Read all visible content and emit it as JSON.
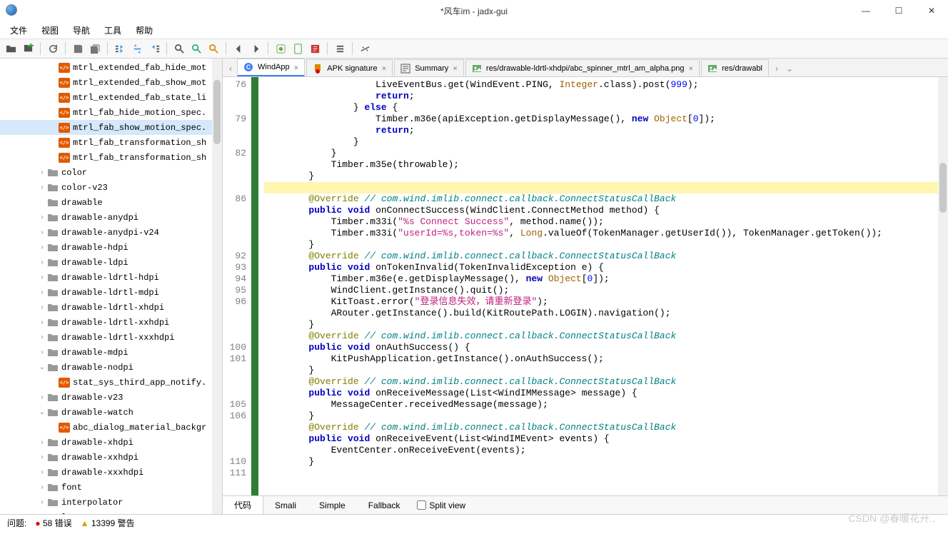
{
  "window": {
    "title": "*风车im - jadx-gui"
  },
  "menus": [
    "文件",
    "视图",
    "导航",
    "工具",
    "帮助"
  ],
  "tree": [
    {
      "d": 4,
      "t": "x",
      "l": "mtrl_extended_fab_hide_mot"
    },
    {
      "d": 4,
      "t": "x",
      "l": "mtrl_extended_fab_show_mot"
    },
    {
      "d": 4,
      "t": "x",
      "l": "mtrl_extended_fab_state_li"
    },
    {
      "d": 4,
      "t": "x",
      "l": "mtrl_fab_hide_motion_spec."
    },
    {
      "d": 4,
      "t": "x",
      "l": "mtrl_fab_show_motion_spec.",
      "sel": true
    },
    {
      "d": 4,
      "t": "x",
      "l": "mtrl_fab_transformation_sh"
    },
    {
      "d": 4,
      "t": "x",
      "l": "mtrl_fab_transformation_sh"
    },
    {
      "d": 3,
      "t": "f",
      "a": ">",
      "l": "color"
    },
    {
      "d": 3,
      "t": "f",
      "a": ">",
      "l": "color-v23"
    },
    {
      "d": 3,
      "t": "f",
      "a": "",
      "l": "drawable"
    },
    {
      "d": 3,
      "t": "f",
      "a": ">",
      "l": "drawable-anydpi"
    },
    {
      "d": 3,
      "t": "f",
      "a": ">",
      "l": "drawable-anydpi-v24"
    },
    {
      "d": 3,
      "t": "f",
      "a": ">",
      "l": "drawable-hdpi"
    },
    {
      "d": 3,
      "t": "f",
      "a": ">",
      "l": "drawable-ldpi"
    },
    {
      "d": 3,
      "t": "f",
      "a": ">",
      "l": "drawable-ldrtl-hdpi"
    },
    {
      "d": 3,
      "t": "f",
      "a": ">",
      "l": "drawable-ldrtl-mdpi"
    },
    {
      "d": 3,
      "t": "f",
      "a": ">",
      "l": "drawable-ldrtl-xhdpi"
    },
    {
      "d": 3,
      "t": "f",
      "a": ">",
      "l": "drawable-ldrtl-xxhdpi"
    },
    {
      "d": 3,
      "t": "f",
      "a": ">",
      "l": "drawable-ldrtl-xxxhdpi"
    },
    {
      "d": 3,
      "t": "f",
      "a": ">",
      "l": "drawable-mdpi"
    },
    {
      "d": 3,
      "t": "f",
      "a": "v",
      "l": "drawable-nodpi"
    },
    {
      "d": 4,
      "t": "x",
      "l": "stat_sys_third_app_notify."
    },
    {
      "d": 3,
      "t": "f",
      "a": ">",
      "l": "drawable-v23"
    },
    {
      "d": 3,
      "t": "f",
      "a": "v",
      "l": "drawable-watch"
    },
    {
      "d": 4,
      "t": "x",
      "l": "abc_dialog_material_backgr"
    },
    {
      "d": 3,
      "t": "f",
      "a": ">",
      "l": "drawable-xhdpi"
    },
    {
      "d": 3,
      "t": "f",
      "a": ">",
      "l": "drawable-xxhdpi"
    },
    {
      "d": 3,
      "t": "f",
      "a": ">",
      "l": "drawable-xxxhdpi"
    },
    {
      "d": 3,
      "t": "f",
      "a": ">",
      "l": "font"
    },
    {
      "d": 3,
      "t": "f",
      "a": ">",
      "l": "interpolator"
    },
    {
      "d": 3,
      "t": "f",
      "a": ">",
      "l": "layout"
    }
  ],
  "tabs": [
    {
      "label": "WindApp",
      "icon": "class",
      "active": true
    },
    {
      "label": "APK signature",
      "icon": "cert",
      "active": false
    },
    {
      "label": "Summary",
      "icon": "sum",
      "active": false
    },
    {
      "label": "res/drawable-ldrtl-xhdpi/abc_spinner_mtrl_am_alpha.png",
      "icon": "img",
      "active": false
    },
    {
      "label": "res/drawabl",
      "icon": "img",
      "active": false,
      "trunc": true
    }
  ],
  "gutter": [
    "76",
    "",
    "",
    "79",
    "",
    "",
    "82",
    "",
    "",
    "",
    "86",
    "",
    "",
    "",
    "",
    "92",
    "93",
    "94",
    "95",
    "96",
    "",
    "",
    "",
    "100",
    "101",
    "",
    "",
    "",
    "105",
    "106",
    "",
    "",
    "",
    "110",
    "111",
    ""
  ],
  "code_lines": [
    [
      [
        "",
        "                    LiveEventBus.get(WindEvent.PING, "
      ],
      [
        "cls",
        "Integer"
      ],
      [
        "",
        ".class).post("
      ],
      [
        "num",
        "999"
      ],
      [
        "",
        ");"
      ]
    ],
    [
      [
        "",
        "                    "
      ],
      [
        "kw",
        "return"
      ],
      [
        "",
        ";"
      ]
    ],
    [
      [
        "",
        "                } "
      ],
      [
        "kw",
        "else"
      ],
      [
        "",
        " {"
      ]
    ],
    [
      [
        "",
        "                    Timber.m36e(apiException.getDisplayMessage(), "
      ],
      [
        "kw",
        "new"
      ],
      [
        "",
        " "
      ],
      [
        "cls",
        "Object"
      ],
      [
        "",
        "["
      ],
      [
        "num",
        "0"
      ],
      [
        "",
        "]);"
      ]
    ],
    [
      [
        "",
        "                    "
      ],
      [
        "kw",
        "return"
      ],
      [
        "",
        ";"
      ]
    ],
    [
      [
        "",
        "                }"
      ]
    ],
    [
      [
        "",
        "            }"
      ]
    ],
    [
      [
        "",
        "            Timber.m35e(throwable);"
      ]
    ],
    [
      [
        "",
        "        }"
      ]
    ],
    [
      [
        "hl",
        ""
      ]
    ],
    [
      [
        "",
        "        "
      ],
      [
        "ann",
        "@Override"
      ],
      [
        "",
        " "
      ],
      [
        "cmt",
        "// com.wind.imlib.connect.callback.ConnectStatusCallBack"
      ]
    ],
    [
      [
        "",
        "        "
      ],
      [
        "kw",
        "public"
      ],
      [
        "",
        " "
      ],
      [
        "kw",
        "void"
      ],
      [
        "",
        " onConnectSuccess(WindClient.ConnectMethod method) {"
      ]
    ],
    [
      [
        "",
        "            Timber.m33i("
      ],
      [
        "str",
        "\"%s Connect Success\""
      ],
      [
        "",
        ", method.name());"
      ]
    ],
    [
      [
        "",
        "            Timber.m33i("
      ],
      [
        "str",
        "\"userId=%s,token=%s\""
      ],
      [
        "",
        ", "
      ],
      [
        "cls",
        "Long"
      ],
      [
        "",
        ".valueOf(TokenManager.getUserId()), TokenManager.getToken());"
      ]
    ],
    [
      [
        "",
        "        }"
      ]
    ],
    [
      [
        "",
        ""
      ]
    ],
    [
      [
        "",
        "        "
      ],
      [
        "ann",
        "@Override"
      ],
      [
        "",
        " "
      ],
      [
        "cmt",
        "// com.wind.imlib.connect.callback.ConnectStatusCallBack"
      ]
    ],
    [
      [
        "",
        "        "
      ],
      [
        "kw",
        "public"
      ],
      [
        "",
        " "
      ],
      [
        "kw",
        "void"
      ],
      [
        "",
        " onTokenInvalid(TokenInvalidException e) {"
      ]
    ],
    [
      [
        "",
        "            Timber.m36e(e.getDisplayMessage(), "
      ],
      [
        "kw",
        "new"
      ],
      [
        "",
        " "
      ],
      [
        "cls",
        "Object"
      ],
      [
        "",
        "["
      ],
      [
        "num",
        "0"
      ],
      [
        "",
        "]);"
      ]
    ],
    [
      [
        "",
        "            WindClient.getInstance().quit();"
      ]
    ],
    [
      [
        "",
        "            KitToast.error("
      ],
      [
        "str",
        "\"登录信息失效，请重新登录\""
      ],
      [
        "",
        ");"
      ]
    ],
    [
      [
        "",
        "            ARouter.getInstance().build(KitRoutePath.LOGIN).navigation();"
      ]
    ],
    [
      [
        "",
        "        }"
      ]
    ],
    [
      [
        "",
        ""
      ]
    ],
    [
      [
        "",
        "        "
      ],
      [
        "ann",
        "@Override"
      ],
      [
        "",
        " "
      ],
      [
        "cmt",
        "// com.wind.imlib.connect.callback.ConnectStatusCallBack"
      ]
    ],
    [
      [
        "",
        "        "
      ],
      [
        "kw",
        "public"
      ],
      [
        "",
        " "
      ],
      [
        "kw",
        "void"
      ],
      [
        "",
        " onAuthSuccess() {"
      ]
    ],
    [
      [
        "",
        "            KitPushApplication.getInstance().onAuthSuccess();"
      ]
    ],
    [
      [
        "",
        "        }"
      ]
    ],
    [
      [
        "",
        ""
      ]
    ],
    [
      [
        "",
        "        "
      ],
      [
        "ann",
        "@Override"
      ],
      [
        "",
        " "
      ],
      [
        "cmt",
        "// com.wind.imlib.connect.callback.ConnectStatusCallBack"
      ]
    ],
    [
      [
        "",
        "        "
      ],
      [
        "kw",
        "public"
      ],
      [
        "",
        " "
      ],
      [
        "kw",
        "void"
      ],
      [
        "",
        " onReceiveMessage(List<WindIMMessage> message) {"
      ]
    ],
    [
      [
        "",
        "            MessageCenter.receivedMessage(message);"
      ]
    ],
    [
      [
        "",
        "        }"
      ]
    ],
    [
      [
        "",
        ""
      ]
    ],
    [
      [
        "",
        "        "
      ],
      [
        "ann",
        "@Override"
      ],
      [
        "",
        " "
      ],
      [
        "cmt",
        "// com.wind.imlib.connect.callback.ConnectStatusCallBack"
      ]
    ],
    [
      [
        "",
        "        "
      ],
      [
        "kw",
        "public"
      ],
      [
        "",
        " "
      ],
      [
        "kw",
        "void"
      ],
      [
        "",
        " onReceiveEvent(List<WindIMEvent> events) {"
      ]
    ],
    [
      [
        "",
        "            EventCenter.onReceiveEvent(events);"
      ]
    ],
    [
      [
        "",
        "        }"
      ]
    ]
  ],
  "bottom_tabs": [
    "代码",
    "Smali",
    "Simple",
    "Fallback"
  ],
  "split_view": "Split view",
  "status": {
    "label": "问题:",
    "errors": "58 错误",
    "warnings": "13399 警告"
  },
  "watermark": "CSDN @春暖花开.,"
}
